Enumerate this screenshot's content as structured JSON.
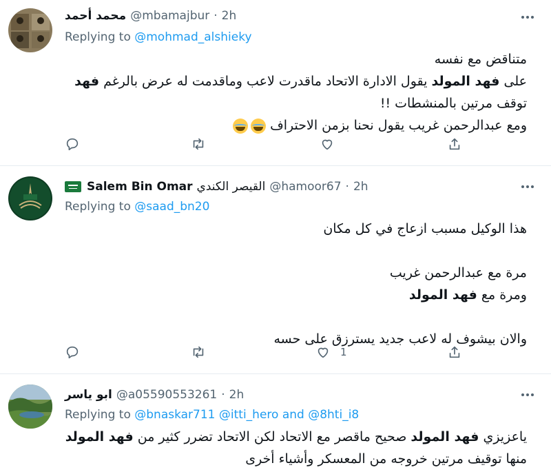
{
  "tweets": [
    {
      "display_name": "محمد أحمد",
      "handle": "@mbamajbur",
      "dot": "·",
      "time": "2h",
      "replying_prefix": "Replying to",
      "replying_to": "@mohmad_alshieky",
      "lines": {
        "l1": "متناقض مع نفسه",
        "l2_pre": "على ",
        "l2_bold": "فهد المولد",
        "l2_post": " يقول الادارة الاتحاد ماقدرت لاعب وماقدمت له عرض بالرغم ",
        "l2_bold2": "فهد",
        "l3": "توقف مرتين بالمنشطات !!",
        "l4": "ومع عبدالرحمن غريب يقول نحنا بزمن الاحتراف"
      },
      "like_count": ""
    },
    {
      "display_name": "Salem Bin Omar",
      "name_suffix": "القيصر الكندي",
      "handle": "@hamoor67",
      "dot": "·",
      "time": "2h",
      "replying_prefix": "Replying to",
      "replying_to": "@saad_bn20",
      "lines": {
        "l1": "هذا الوكيل مسبب ازعاج في كل مكان",
        "l2": "مرة مع عبدالرحمن غريب",
        "l3_pre": "ومرة مع ",
        "l3_bold": "فهد المولد",
        "l4": "والان بيشوف له لاعب جديد يسترزق على حسه"
      },
      "like_count": "1"
    },
    {
      "display_name": "ابو ياسر",
      "handle": "@a05590553261",
      "dot": "·",
      "time": "2h",
      "replying_prefix": "Replying to",
      "replying_to": "@bnaskar711 @itti_hero and @8hti_i8",
      "lines": {
        "l1_pre": "ياعزيزي ",
        "l1_bold": "فهد المولد",
        "l1_mid": " صحيح ماقصر مع الاتحاد لكن الاتحاد تضرر كثير من ",
        "l1_bold2": "فهد المولد",
        "l2": "منها توقيف مرتين خروجه من المعسكر وأشياء أخرى"
      }
    }
  ],
  "icons": [
    "reply-icon",
    "retweet-icon",
    "like-icon",
    "share-icon",
    "more-icon"
  ],
  "colors": {
    "link": "#1d9bf0",
    "secondary": "#536471",
    "divider": "#e6ecf0"
  }
}
